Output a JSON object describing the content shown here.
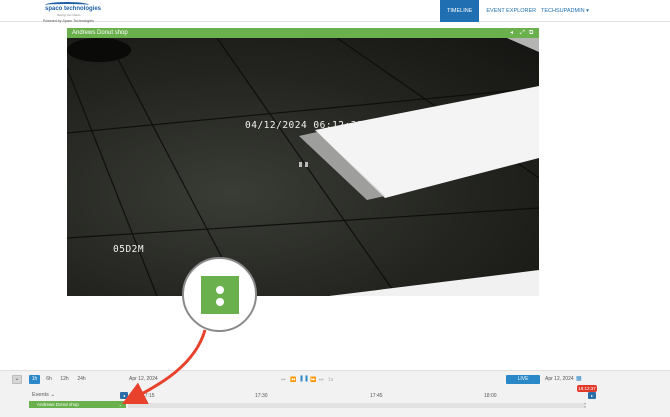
{
  "header": {
    "brand": "spaco technologies",
    "tagline": "Giving You Vision",
    "powered_by": "Powered by Spaco Technologies",
    "nav": [
      {
        "label": "TIMELINE",
        "active": true
      },
      {
        "label": "EVENT EXPLORER",
        "active": false
      }
    ],
    "user": "TECHSUPADMIN ▾"
  },
  "camera": {
    "title": "Andrews Donut shop",
    "controls": [
      "◂",
      "⤢",
      "⧉"
    ],
    "osd_datetime": "04/12/2024 06:12:31PM",
    "osd_camera_name": "05D2M"
  },
  "timeline": {
    "ranges": [
      {
        "label": "1h",
        "active": true
      },
      {
        "label": "6h",
        "active": false
      },
      {
        "label": "12h",
        "active": false
      },
      {
        "label": "24h",
        "active": false
      }
    ],
    "left_date": "Apr 12, 2024",
    "playback": [
      "⏮",
      "⏪",
      "❚❚",
      "⏩",
      "⏭",
      "1x"
    ],
    "live_label": "LIVE",
    "right_date": "Apr 12, 2024",
    "current_time": "18:12:37",
    "events_label": "Events ⌄",
    "ticks": [
      "17:15",
      "17:30",
      "17:45",
      "18:00"
    ],
    "camera_row": "Andrews Donut shop",
    "camera_row_chevron": "⌄",
    "prev_arrow": "◂",
    "next_arrow": "▸",
    "collapse_icon": "⌄"
  },
  "colors": {
    "accent_blue": "#1f6fb2",
    "camera_green": "#6ab04c",
    "alert_red": "#e23a2a",
    "annotation_arrow": "#e8412c"
  }
}
